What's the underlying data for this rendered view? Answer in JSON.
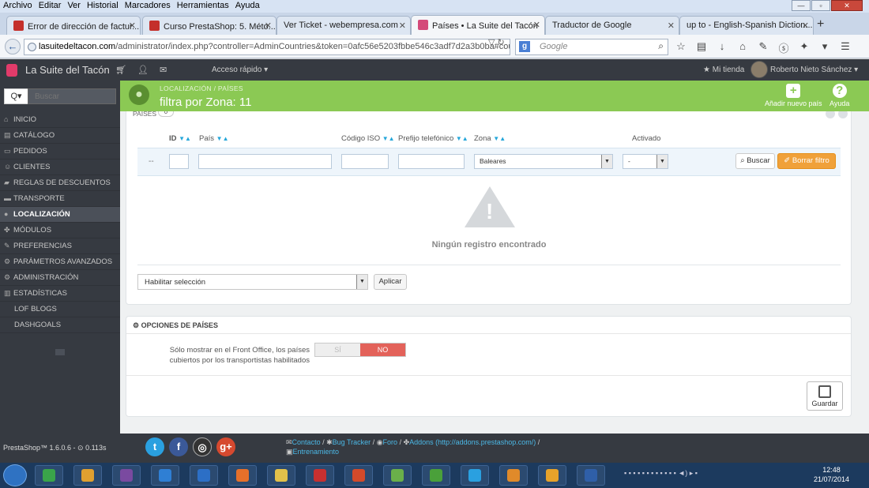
{
  "browser": {
    "menu": [
      "Archivo",
      "Editar",
      "Ver",
      "Historial",
      "Marcadores",
      "Herramientas",
      "Ayuda"
    ],
    "tabs": [
      {
        "label": "Error de dirección de factur...",
        "favicon_color": "#c4302b"
      },
      {
        "label": "Curso PrestaShop: 5. Méto...",
        "favicon_color": "#c4302b"
      },
      {
        "label": "Ver Ticket - webempresa.com",
        "favicon_color": ""
      },
      {
        "label": "Países • La Suite del Tacón",
        "favicon_color": "#d44a7a",
        "active": true
      },
      {
        "label": "Traductor de Google",
        "favicon_color": ""
      },
      {
        "label": "up to - English-Spanish Diction...",
        "favicon_color": ""
      }
    ],
    "url_host": "lasuitedeltacon.com",
    "url_path": "/administrator/index.php?controller=AdminCountries&token=0afc56e5203fbbe546c3adf7d2a3b0ba#country",
    "search_placeholder": "Google",
    "search_engine_letter": "g"
  },
  "header": {
    "shop_name": "La Suite del Tacón",
    "quick_access": "Acceso rápido ▾",
    "my_shop": "★ Mi tienda",
    "user_name": "Roberto Nieto Sánchez ▾"
  },
  "sidebar": {
    "search_placeholder": "Buscar",
    "search_btn": "Q▾",
    "items": [
      {
        "label": "INICIO",
        "icon": "⌂"
      },
      {
        "label": "CATÁLOGO",
        "icon": "▤"
      },
      {
        "label": "PEDIDOS",
        "icon": "▭"
      },
      {
        "label": "CLIENTES",
        "icon": "☺"
      },
      {
        "label": "REGLAS DE DESCUENTOS",
        "icon": "▰"
      },
      {
        "label": "TRANSPORTE",
        "icon": "▬"
      },
      {
        "label": "LOCALIZACIÓN",
        "icon": "●",
        "active": true
      },
      {
        "label": "MÓDULOS",
        "icon": "✤"
      },
      {
        "label": "PREFERENCIAS",
        "icon": "✎"
      },
      {
        "label": "PARÁMETROS AVANZADOS",
        "icon": "⚙"
      },
      {
        "label": "ADMINISTRACIÓN",
        "icon": "⚙"
      },
      {
        "label": "ESTADÍSTICAS",
        "icon": "▥"
      },
      {
        "label": "LOF BLOGS",
        "icon": "",
        "sub": true
      },
      {
        "label": "DASHGOALS",
        "icon": "",
        "sub": true
      }
    ]
  },
  "page_head": {
    "breadcrumb": "LOCALIZACIÓN  /  PAÍSES",
    "title": "filtra por Zona: 11",
    "add_label": "Añadir nuevo país",
    "help_label": "Ayuda"
  },
  "list_panel": {
    "title": "PAÍSES",
    "count": "0",
    "columns": {
      "id": "ID",
      "pais": "País",
      "iso": "Código ISO",
      "prefijo": "Prefijo telefónico",
      "zona": "Zona",
      "activado": "Activado"
    },
    "filter_dash": "--",
    "zona_value": "Baleares",
    "activado_value": "-",
    "buscar_label": "Buscar",
    "borrar_label": "Borrar filtro",
    "empty_text": "Ningún registro encontrado",
    "bulk_label": "Habilitar selección",
    "apply_label": "Aplicar"
  },
  "options_panel": {
    "title": "OPCIONES DE PAÍSES",
    "option_label": "Sólo mostrar en el Front Office, los países cubiertos por los transportistas habilitados",
    "toggle_si": "SÍ",
    "toggle_no": "NO",
    "save_label": "Guardar"
  },
  "footer": {
    "version": "PrestaShop™ 1.6.0.6 - ⊙ 0.113s",
    "links": [
      "Contacto",
      "Bug Tracker",
      "Foro",
      "Addons (http://addons.prestashop.com/)",
      "Entrenamiento"
    ]
  },
  "taskbar": {
    "clock_time": "12:48",
    "clock_date": "21/07/2014",
    "apps": [
      {
        "name": "chrome-icon",
        "color": "#3aa44a"
      },
      {
        "name": "paint-icon",
        "color": "#e0a030"
      },
      {
        "name": "media-icon",
        "color": "#7a4aa0"
      },
      {
        "name": "dropbox-icon",
        "color": "#2f7fd4"
      },
      {
        "name": "power-icon",
        "color": "#2c6fc6"
      },
      {
        "name": "firefox-icon",
        "color": "#e6702a"
      },
      {
        "name": "explorer-icon",
        "color": "#e2c14a"
      },
      {
        "name": "filezilla-icon",
        "color": "#c83030"
      },
      {
        "name": "ccleaner-icon",
        "color": "#d34a2a"
      },
      {
        "name": "dreamweaver-icon",
        "color": "#6ab04a"
      },
      {
        "name": "utorrent-icon",
        "color": "#4aa03a"
      },
      {
        "name": "skype-icon",
        "color": "#2aa0e0"
      },
      {
        "name": "player-icon",
        "color": "#e08a2a"
      },
      {
        "name": "outlook-icon",
        "color": "#e6a22a"
      },
      {
        "name": "word-icon",
        "color": "#2f5fa8"
      }
    ]
  }
}
